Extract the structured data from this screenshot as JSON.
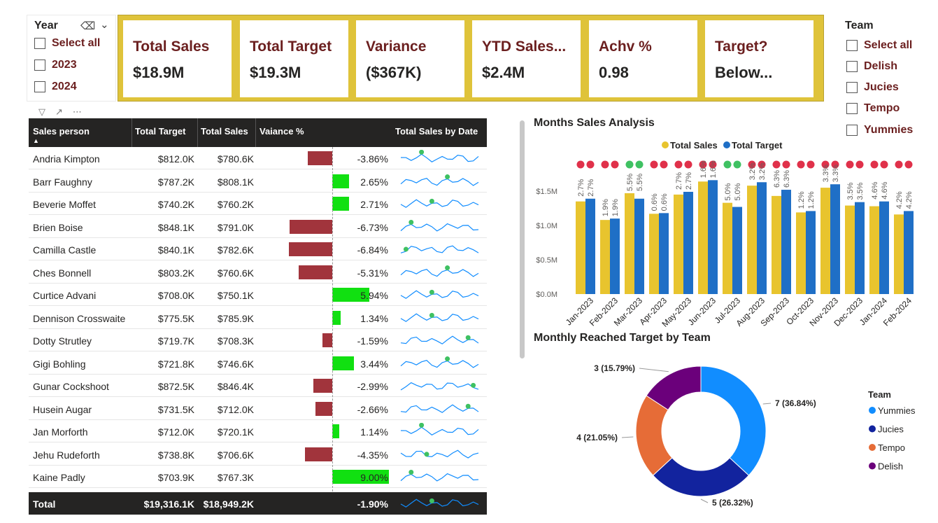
{
  "year_slicer": {
    "title": "Year",
    "options": [
      "Select all",
      "2023",
      "2024"
    ]
  },
  "kpis": [
    {
      "label": "Total Sales",
      "value": "$18.9M"
    },
    {
      "label": "Total Target",
      "value": "$19.3M"
    },
    {
      "label": "Variance",
      "value": "($367K)"
    },
    {
      "label": "YTD Sales...",
      "value": "$2.4M"
    },
    {
      "label": "Achv %",
      "value": "0.98"
    },
    {
      "label": "Target?",
      "value": "Below..."
    }
  ],
  "team_slicer": {
    "title": "Team",
    "options": [
      "Select all",
      "Delish",
      "Jucies",
      "Tempo",
      "Yummies"
    ]
  },
  "table": {
    "headers": {
      "sales_person": "Sales person",
      "total_target": "Total Target",
      "total_sales": "Total Sales",
      "variance": "Vaiance %",
      "trend": "Total Sales by Date"
    },
    "rows": [
      {
        "name": "Andria Kimpton",
        "target": "$812.0K",
        "sales": "$780.6K",
        "variance": "-3.86%",
        "var_value": -3.86,
        "dot": 4
      },
      {
        "name": "Barr Faughny",
        "target": "$787.2K",
        "sales": "$808.1K",
        "variance": "2.65%",
        "var_value": 2.65,
        "dot": 9
      },
      {
        "name": "Beverie Moffet",
        "target": "$740.2K",
        "sales": "$760.2K",
        "variance": "2.71%",
        "var_value": 2.71,
        "dot": 6
      },
      {
        "name": "Brien Boise",
        "target": "$848.1K",
        "sales": "$791.0K",
        "variance": "-6.73%",
        "var_value": -6.73,
        "dot": 2
      },
      {
        "name": "Camilla Castle",
        "target": "$840.1K",
        "sales": "$782.6K",
        "variance": "-6.84%",
        "var_value": -6.84,
        "dot": 1
      },
      {
        "name": "Ches Bonnell",
        "target": "$803.2K",
        "sales": "$760.6K",
        "variance": "-5.31%",
        "var_value": -5.31,
        "dot": 9
      },
      {
        "name": "Curtice Advani",
        "target": "$708.0K",
        "sales": "$750.1K",
        "variance": "5.94%",
        "var_value": 5.94,
        "dot": 6
      },
      {
        "name": "Dennison Crosswaite",
        "target": "$775.5K",
        "sales": "$785.9K",
        "variance": "1.34%",
        "var_value": 1.34,
        "dot": 6
      },
      {
        "name": "Dotty Strutley",
        "target": "$719.7K",
        "sales": "$708.3K",
        "variance": "-1.59%",
        "var_value": -1.59,
        "dot": 13
      },
      {
        "name": "Gigi Bohling",
        "target": "$721.8K",
        "sales": "$746.6K",
        "variance": "3.44%",
        "var_value": 3.44,
        "dot": 9
      },
      {
        "name": "Gunar Cockshoot",
        "target": "$872.5K",
        "sales": "$846.4K",
        "variance": "-2.99%",
        "var_value": -2.99,
        "dot": 14
      },
      {
        "name": "Husein Augar",
        "target": "$731.5K",
        "sales": "$712.0K",
        "variance": "-2.66%",
        "var_value": -2.66,
        "dot": 13
      },
      {
        "name": "Jan Morforth",
        "target": "$712.0K",
        "sales": "$720.1K",
        "variance": "1.14%",
        "var_value": 1.14,
        "dot": 4
      },
      {
        "name": "Jehu Rudeforth",
        "target": "$738.8K",
        "sales": "$706.6K",
        "variance": "-4.35%",
        "var_value": -4.35,
        "dot": 5
      },
      {
        "name": "Kaine Padly",
        "target": "$703.9K",
        "sales": "$767.3K",
        "variance": "9.00%",
        "var_value": 9.0,
        "dot": 2
      }
    ],
    "total": {
      "name": "Total",
      "target": "$19,316.1K",
      "sales": "$18,949.2K",
      "variance": "-1.90%",
      "dot": 6
    }
  },
  "colors": {
    "kpi_banner": "#dfc33a",
    "label_maroon": "#6b1f1f",
    "neg_bar": "#a1343c",
    "pos_bar": "#11e011",
    "sales_bar": "#e8c42e",
    "target_bar": "#1f6fc6",
    "sparkline": "#118dff",
    "red_dot": "#e0314a",
    "green_dot": "#3fc162"
  },
  "chart_data": [
    {
      "type": "bar",
      "title": "Months Sales Analysis",
      "categories": [
        "Jan-2023",
        "Feb-2023",
        "Mar-2023",
        "Apr-2023",
        "May-2023",
        "Jun-2023",
        "Jul-2023",
        "Aug-2023",
        "Sep-2023",
        "Oct-2023",
        "Nov-2023",
        "Dec-2023",
        "Jan-2024",
        "Feb-2024"
      ],
      "series": [
        {
          "name": "Total Sales",
          "values": [
            1.35,
            1.08,
            1.47,
            1.17,
            1.45,
            1.64,
            1.33,
            1.58,
            1.43,
            1.19,
            1.55,
            1.29,
            1.28,
            1.16
          ]
        },
        {
          "name": "Total Target",
          "values": [
            1.39,
            1.1,
            1.39,
            1.18,
            1.49,
            1.66,
            1.27,
            1.63,
            1.52,
            1.21,
            1.6,
            1.34,
            1.35,
            1.21
          ]
        }
      ],
      "labels_sales": [
        "2.7%",
        "1.9%",
        "5.5%",
        "0.6%",
        "2.7%",
        "1.6%",
        "5.0%",
        "3.2%",
        "6.3%",
        "1.2%",
        "3.3%",
        "3.5%",
        "4.6%",
        "4.2%"
      ],
      "labels_target": [
        "2.7%",
        "1.9%",
        "5.5%",
        "0.6%",
        "2.7%",
        "1.6%",
        "5.0%",
        "3.2%",
        "6.3%",
        "1.2%",
        "3.3%",
        "3.5%",
        "4.6%",
        "4.2%"
      ],
      "status": [
        "red",
        "red",
        "green",
        "red",
        "red",
        "red",
        "green",
        "red",
        "red",
        "red",
        "red",
        "red",
        "red",
        "red"
      ],
      "yticks": [
        "$0.0M",
        "$0.5M",
        "$1.0M",
        "$1.5M"
      ],
      "ylim": [
        0,
        2.0
      ],
      "unit": "$M",
      "legend_position": "top"
    },
    {
      "type": "pie",
      "title": "Monthly Reached Target by Team",
      "legend_title": "Team",
      "slices": [
        {
          "name": "Yummies",
          "value": 7,
          "label": "7 (36.84%)",
          "color": "#118dff"
        },
        {
          "name": "Jucies",
          "value": 5,
          "label": "5 (26.32%)",
          "color": "#12239e"
        },
        {
          "name": "Tempo",
          "value": 4,
          "label": "4 (21.05%)",
          "color": "#e66c37"
        },
        {
          "name": "Delish",
          "value": 3,
          "label": "3 (15.79%)",
          "color": "#6b007b"
        }
      ],
      "legend_position": "right"
    }
  ]
}
